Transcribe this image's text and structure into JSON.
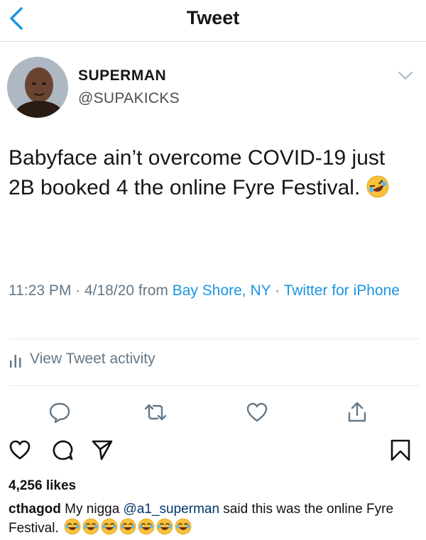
{
  "header": {
    "title": "Tweet",
    "back_label": "back"
  },
  "tweet": {
    "name": "SUPERMAN",
    "handle": "@SUPAKICKS",
    "text": "Babyface ain’t overcome COVID-19 just 2B booked 4 the online Fyre Festival.",
    "emoji": "rolling-on-floor-laughing",
    "time": "11:23 PM · 4/18/20 from ",
    "location": "Bay Shore, NY",
    "sep": " · ",
    "source": "Twitter for iPhone",
    "activity_label": "View Tweet activity"
  },
  "instagram": {
    "likes": "4,256 likes",
    "comment": {
      "user": "cthagod",
      "text_before": " My nigga ",
      "mention": "@a1_superman",
      "text_after": " said this was the online Fyre Festival. ",
      "emoji_count": 7
    }
  },
  "colors": {
    "twitter_blue": "#1b95e0",
    "meta_gray": "#657786",
    "emoji_yellow": "#f7c23a"
  }
}
